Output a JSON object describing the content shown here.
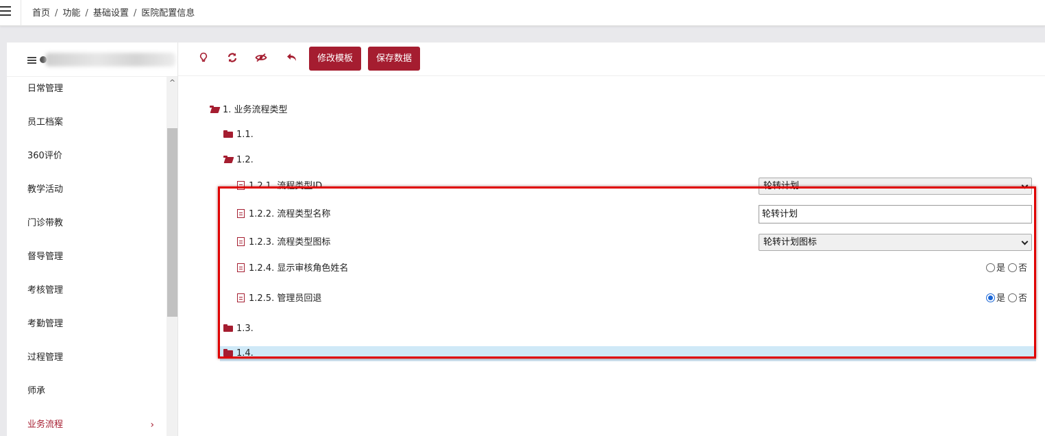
{
  "breadcrumb": [
    "首页",
    "功能",
    "基础设置",
    "医院配置信息"
  ],
  "breadcrumb_sep": "/",
  "sidebar": {
    "items": [
      {
        "label": "日常管理"
      },
      {
        "label": "员工档案"
      },
      {
        "label": "360评价"
      },
      {
        "label": "教学活动"
      },
      {
        "label": "门诊带教"
      },
      {
        "label": "督导管理"
      },
      {
        "label": "考核管理"
      },
      {
        "label": "考勤管理"
      },
      {
        "label": "过程管理"
      },
      {
        "label": "师承"
      },
      {
        "label": "业务流程",
        "active": true
      }
    ]
  },
  "toolbar": {
    "icons": [
      "lightbulb-icon",
      "refresh-icon",
      "hide-icon",
      "undo-icon"
    ],
    "edit_template_label": "修改模板",
    "save_data_label": "保存数据"
  },
  "tree": {
    "root": {
      "label": "1. 业务流程类型"
    },
    "n1_1": {
      "label": "1.1."
    },
    "n1_2": {
      "label": "1.2."
    },
    "leaves": [
      {
        "label": "1.2.1. 流程类型ID",
        "control": "select",
        "value": "轮转计划"
      },
      {
        "label": "1.2.2. 流程类型名称",
        "control": "input",
        "value": "轮转计划"
      },
      {
        "label": "1.2.3. 流程类型图标",
        "control": "select",
        "value": "轮转计划图标"
      },
      {
        "label": "1.2.4. 显示审核角色姓名",
        "control": "radio",
        "options": [
          "是",
          "否"
        ],
        "selected": null
      },
      {
        "label": "1.2.5. 管理员回退",
        "control": "radio",
        "options": [
          "是",
          "否"
        ],
        "selected": "是"
      }
    ],
    "n1_3": {
      "label": "1.3."
    },
    "n1_4": {
      "label": "1.4.",
      "highlighted": true
    }
  },
  "colors": {
    "accent": "#a51d30",
    "highlight": "#cfe9f7",
    "annotation": "#e00000",
    "radio_on": "#1a66d6"
  }
}
